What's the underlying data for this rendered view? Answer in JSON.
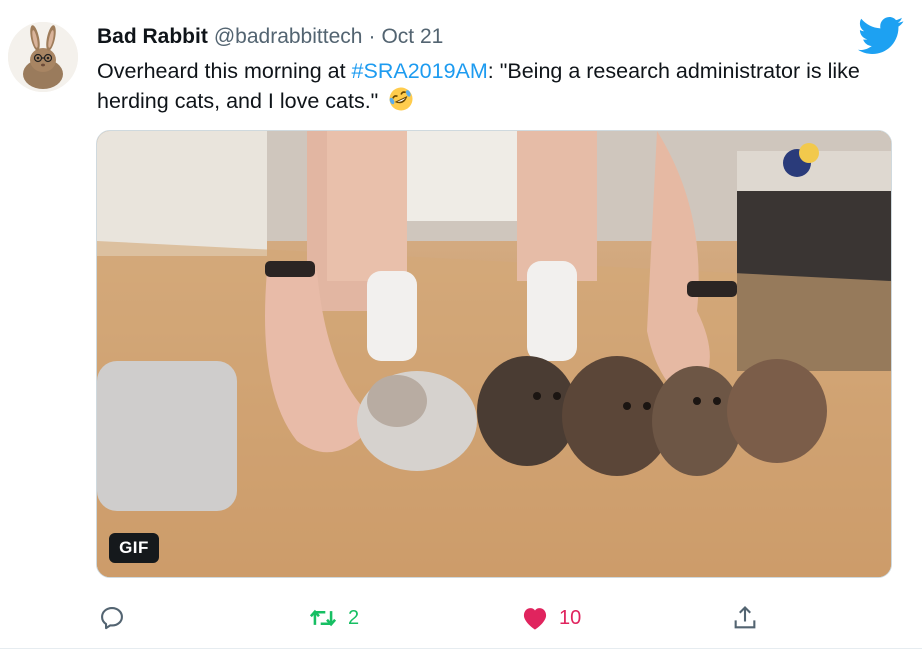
{
  "tweet": {
    "author": {
      "display_name": "Bad Rabbit",
      "handle": "@badrabbittech",
      "avatar_icon": "rabbit-avatar"
    },
    "separator": "·",
    "date": "Oct 21",
    "text": {
      "before_hashtag": "Overheard this morning at ",
      "hashtag": "#SRA2019AM",
      "after_hashtag": ": \"Being a research administrator is like herding cats, and I love cats.\" ",
      "emoji_icon": "rolling-on-floor-laughing-emoji"
    },
    "media": {
      "badge": "GIF",
      "description_icon": "kittens-gif-image"
    },
    "actions": {
      "reply": {
        "icon": "reply-icon",
        "count": ""
      },
      "retweet": {
        "icon": "retweet-icon",
        "count": "2"
      },
      "like": {
        "icon": "heart-icon",
        "count": "10"
      },
      "share": {
        "icon": "share-icon"
      }
    },
    "brand_icon": "twitter-bird-icon"
  },
  "colors": {
    "text": "#0f1419",
    "secondary": "#536471",
    "link": "#1d9bf0",
    "retweet": "#17bf63",
    "like": "#e0245e",
    "twitter_blue": "#1da1f2"
  }
}
